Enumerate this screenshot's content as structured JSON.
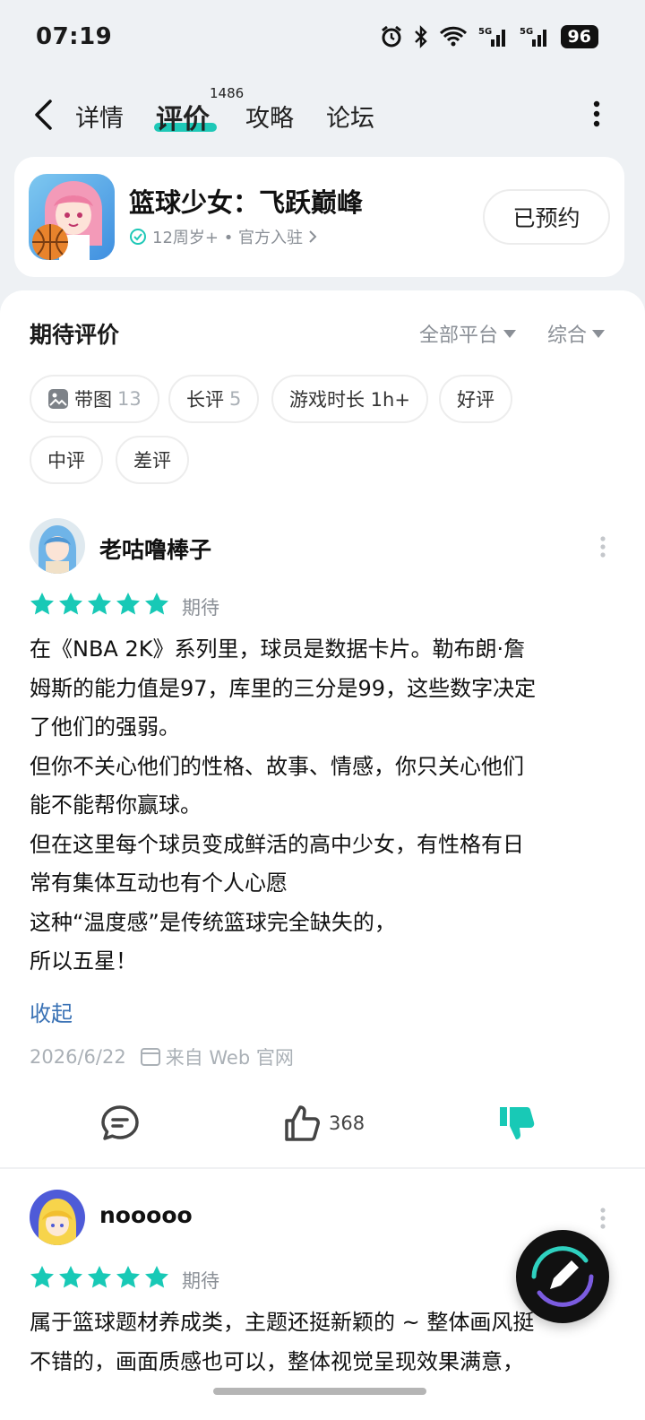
{
  "status_bar": {
    "time": "07:19",
    "battery": "96"
  },
  "nav": {
    "tabs": [
      {
        "label": "详情"
      },
      {
        "label": "评价",
        "count": "1486"
      },
      {
        "label": "攻略"
      },
      {
        "label": "论坛"
      }
    ]
  },
  "game": {
    "title": "篮球少女：飞跃巅峰",
    "meta": "12周岁+ • 官方入驻",
    "reserve_label": "已预约"
  },
  "reviews_panel": {
    "title": "期待评价",
    "platform_filter": "全部平台",
    "sort_filter": "综合",
    "chips": [
      {
        "label": "带图",
        "count": "13"
      },
      {
        "label": "长评",
        "count": "5"
      },
      {
        "label": "游戏时长 1h+"
      },
      {
        "label": "好评"
      },
      {
        "label": "中评"
      },
      {
        "label": "差评"
      }
    ]
  },
  "reviews": [
    {
      "username": "老咕噜棒子",
      "rating": 5,
      "tag": "期待",
      "text": "在《NBA 2K》系列里，球员是数据卡片。勒布朗·詹\n姆斯的能力值是97，库里的三分是99，这些数字决定\n了他们的强弱。\n但你不关心他们的性格、故事、情感，你只关心他们\n能不能帮你赢球。\n但在这里每个球员变成鲜活的高中少女，有性格有日\n常有集体互动也有个人心愿\n这种“温度感”是传统篮球完全缺失的，\n所以五星！",
      "collapse_label": "收起",
      "date": "2026/6/22",
      "source": "来自 Web 官网",
      "likes": "368"
    },
    {
      "username": "nooooo",
      "rating": 5,
      "tag": "期待",
      "text": "属于篮球题材养成类，主题还挺新颖的 ~ 整体画风挺\n不错的，画面质感也可以，整体视觉呈现效果满意，"
    }
  ],
  "colors": {
    "accent": "#1ec8b7",
    "link": "#3a72b5",
    "star": "#18c9b6"
  }
}
